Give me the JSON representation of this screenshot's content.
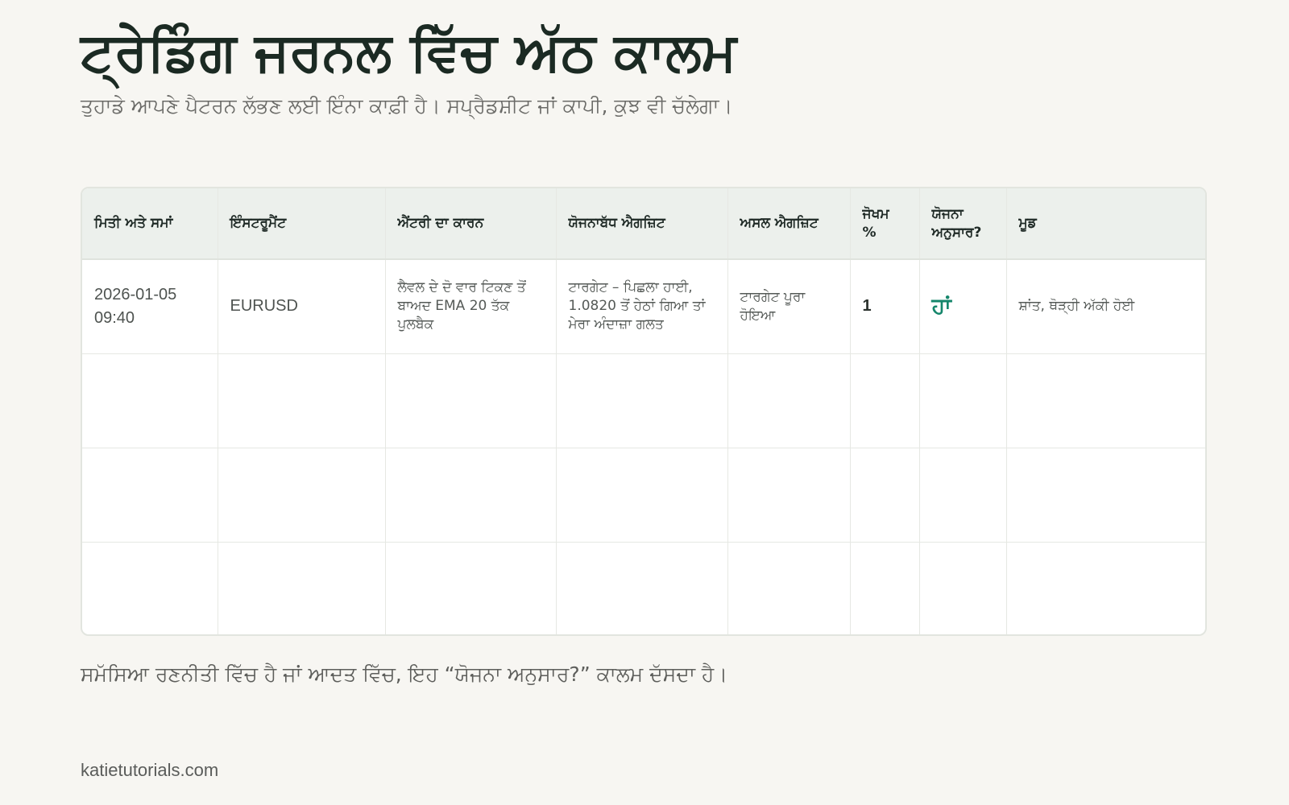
{
  "title": "ਟ੍ਰੇਡਿੰਗ ਜਰਨਲ ਵਿੱਚ ਅੱਠ ਕਾਲਮ",
  "subtitle": "ਤੁਹਾਡੇ ਆਪਣੇ ਪੈਟਰਨ ਲੱਭਣ ਲਈ ਇੰਨਾ ਕਾਫ਼ੀ ਹੈ। ਸਪ੍ਰੈਡਸ਼ੀਟ ਜਾਂ ਕਾਪੀ, ਕੁਝ ਵੀ ਚੱਲੇਗਾ।",
  "table": {
    "headers": [
      "ਮਿਤੀ ਅਤੇ ਸਮਾਂ",
      "ਇੰਸਟਰੂਮੈਂਟ",
      "ਐਂਟਰੀ ਦਾ ਕਾਰਨ",
      "ਯੋਜਨਾਬੱਧ ਐਗਜ਼ਿਟ",
      "ਅਸਲ ਐਗਜ਼ਿਟ",
      "ਜੋਖਮ %",
      "ਯੋਜਨਾ ਅਨੁਸਾਰ?",
      "ਮੂਡ"
    ],
    "row1": {
      "date": "2026-01-05 09:40",
      "instrument": "EURUSD",
      "reason": "ਲੈਵਲ ਦੇ ਦੋ ਵਾਰ ਟਿਕਣ ਤੋਂ ਬਾਅਦ EMA 20 ਤੱਕ ਪੁਲਬੈਕ",
      "planned_exit": "ਟਾਰਗੇਟ – ਪਿਛਲਾ ਹਾਈ, 1.0820 ਤੋਂ ਹੇਠਾਂ ਗਿਆ ਤਾਂ ਮੇਰਾ ਅੰਦਾਜ਼ਾ ਗਲਤ",
      "actual_exit": "ਟਾਰਗੇਟ ਪੂਰਾ ਹੋਇਆ",
      "risk": "1",
      "per_plan": "ਹਾਂ",
      "mood": "ਸ਼ਾਂਤ, ਥੋੜ੍ਹੀ ਅੱਕੀ ਹੋਈ"
    }
  },
  "note": "ਸਮੱਸਿਆ ਰਣਨੀਤੀ ਵਿੱਚ ਹੈ ਜਾਂ ਆਦਤ ਵਿੱਚ, ਇਹ “ਯੋਜਨਾ ਅਨੁਸਾਰ?” ਕਾਲਮ ਦੱਸਦਾ ਹੈ।",
  "footer": "katietutorials.com",
  "colors": {
    "background": "#f7f6f2",
    "header_row": "#ecf0ec",
    "accent_green": "#15866b"
  }
}
